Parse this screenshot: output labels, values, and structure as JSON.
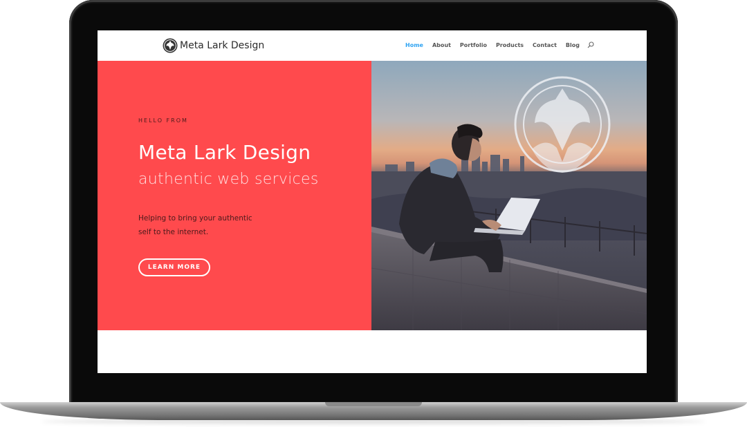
{
  "site": {
    "logo_text": "Meta Lark Design",
    "logo_icon": "lark-emblem-icon"
  },
  "nav": {
    "items": [
      {
        "label": "Home",
        "active": true
      },
      {
        "label": "About",
        "active": false
      },
      {
        "label": "Portfolio",
        "active": false
      },
      {
        "label": "Products",
        "active": false
      },
      {
        "label": "Contact",
        "active": false
      },
      {
        "label": "Blog",
        "active": false
      }
    ],
    "search_icon": "search-icon",
    "active_color": "#2ea3f2"
  },
  "hero": {
    "eyebrow": "HELLO FROM",
    "title": "Meta Lark Design",
    "subtitle": "authentic web services",
    "body_line1": "Helping to bring your authentic",
    "body_line2": "self to the internet.",
    "cta_label": "LEARN MORE",
    "background_color": "#ff4a4d"
  }
}
